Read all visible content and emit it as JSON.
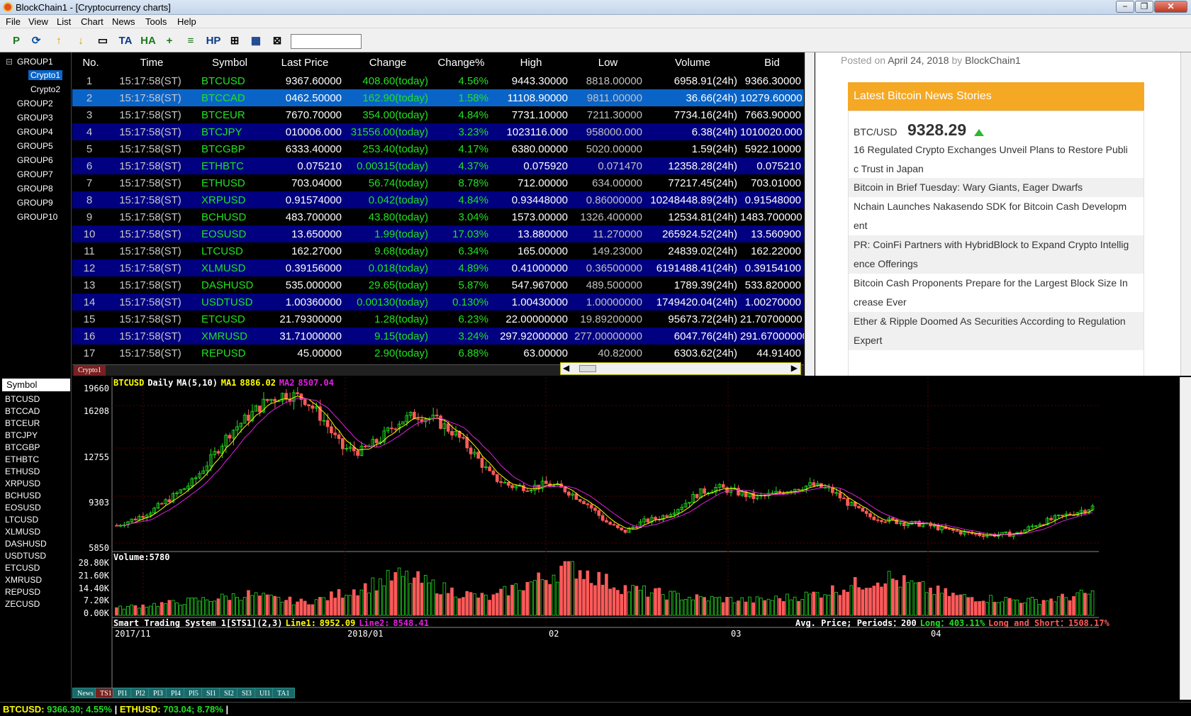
{
  "window": {
    "title": "BlockChain1 - [Cryptocurrency charts]",
    "min": "−",
    "restore": "❐",
    "close": "✕"
  },
  "menu": [
    "File",
    "View",
    "List",
    "Chart",
    "News",
    "Tools",
    "Help"
  ],
  "toolbar": {
    "buttons": [
      "P",
      "⟳",
      "↑",
      "↓",
      "▭",
      "TA",
      "HA",
      "+",
      "≡",
      "HP",
      "⊞",
      "▦",
      "⊠"
    ],
    "icons": [
      "p-icon",
      "refresh-icon",
      "up-icon",
      "down-icon",
      "window-icon",
      "ta-icon",
      "ha-icon",
      "crosshair-icon",
      "list-icon",
      "hp-icon",
      "grid-icon",
      "table-icon",
      "close-box-icon"
    ],
    "search_value": ""
  },
  "tree": {
    "groups": [
      "GROUP1",
      "Crypto1",
      "Crypto2",
      "GROUP2",
      "GROUP3",
      "GROUP4",
      "GROUP5",
      "GROUP6",
      "GROUP7",
      "GROUP8",
      "GROUP9",
      "GROUP10"
    ],
    "expand": "⊟",
    "selected": "Crypto1"
  },
  "grid": {
    "columns": [
      "No.",
      "Time",
      "Symbol",
      "Last Price",
      "Change",
      "Change%",
      "High",
      "Low",
      "Volume",
      "Bid"
    ],
    "rows": [
      [
        "1",
        "15:17:58(ST)",
        "BTCUSD",
        "9367.60000",
        "408.60(today)",
        "4.56%",
        "9443.30000",
        "8818.00000",
        "6958.91(24h)",
        "9366.30000"
      ],
      [
        "2",
        "15:17:58(ST)",
        "BTCCAD",
        "0462.50000",
        "162.90(today)",
        "1.58%",
        "11108.90000",
        "9811.00000",
        "36.66(24h)",
        "10279.60000"
      ],
      [
        "3",
        "15:17:58(ST)",
        "BTCEUR",
        "7670.70000",
        "354.00(today)",
        "4.84%",
        "7731.10000",
        "7211.30000",
        "7734.16(24h)",
        "7663.90000"
      ],
      [
        "4",
        "15:17:58(ST)",
        "BTCJPY",
        "010006.000",
        "31556.00(today)",
        "3.23%",
        "1023116.000",
        "958000.000",
        "6.38(24h)",
        "1010020.000"
      ],
      [
        "5",
        "15:17:58(ST)",
        "BTCGBP",
        "6333.40000",
        "253.40(today)",
        "4.17%",
        "6380.00000",
        "5020.00000",
        "1.59(24h)",
        "5922.10000"
      ],
      [
        "6",
        "15:17:58(ST)",
        "ETHBTC",
        "0.075210",
        "0.00315(today)",
        "4.37%",
        "0.075920",
        "0.071470",
        "12358.28(24h)",
        "0.075210"
      ],
      [
        "7",
        "15:17:58(ST)",
        "ETHUSD",
        "703.04000",
        "56.74(today)",
        "8.78%",
        "712.00000",
        "634.00000",
        "77217.45(24h)",
        "703.01000"
      ],
      [
        "8",
        "15:17:58(ST)",
        "XRPUSD",
        "0.91574000",
        "0.042(today)",
        "4.84%",
        "0.93448000",
        "0.86000000",
        "10248448.89(24h)",
        "0.91548000"
      ],
      [
        "9",
        "15:17:58(ST)",
        "BCHUSD",
        "483.700000",
        "43.80(today)",
        "3.04%",
        "1573.00000",
        "1326.400000",
        "12534.81(24h)",
        "1483.700000"
      ],
      [
        "10",
        "15:17:58(ST)",
        "EOSUSD",
        "13.650000",
        "1.99(today)",
        "17.03%",
        "13.880000",
        "11.270000",
        "265924.52(24h)",
        "13.560900"
      ],
      [
        "11",
        "15:17:58(ST)",
        "LTCUSD",
        "162.27000",
        "9.68(today)",
        "6.34%",
        "165.00000",
        "149.23000",
        "24839.02(24h)",
        "162.22000"
      ],
      [
        "12",
        "15:17:58(ST)",
        "XLMUSD",
        "0.39156000",
        "0.018(today)",
        "4.89%",
        "0.41000000",
        "0.36500000",
        "6191488.41(24h)",
        "0.39154100"
      ],
      [
        "13",
        "15:17:58(ST)",
        "DASHUSD",
        "535.000000",
        "29.65(today)",
        "5.87%",
        "547.967000",
        "489.500000",
        "1789.39(24h)",
        "533.820000"
      ],
      [
        "14",
        "15:17:58(ST)",
        "USDTUSD",
        "1.00360000",
        "0.00130(today)",
        "0.130%",
        "1.00430000",
        "1.00000000",
        "1749420.04(24h)",
        "1.00270000"
      ],
      [
        "15",
        "15:17:58(ST)",
        "ETCUSD",
        "21.79300000",
        "1.28(today)",
        "6.23%",
        "22.00000000",
        "19.89200000",
        "95673.72(24h)",
        "21.70700000"
      ],
      [
        "16",
        "15:17:58(ST)",
        "XMRUSD",
        "31.71000000",
        "9.15(today)",
        "3.24%",
        "297.92000000",
        "277.00000000",
        "6047.76(24h)",
        "291.67000000"
      ],
      [
        "17",
        "15:17:58(ST)",
        "REPUSD",
        "45.00000",
        "2.90(today)",
        "6.88%",
        "63.00000",
        "40.82000",
        "6303.62(24h)",
        "44.91400"
      ]
    ],
    "tab": "Crypto1"
  },
  "news": {
    "posted_prefix": "Posted on",
    "posted_date": "April 24, 2018",
    "posted_by": "by",
    "author": "BlockChain1",
    "heading": "Latest Bitcoin News Stories",
    "pair": "BTC/USD",
    "price": "9328.29",
    "stories": [
      [
        "16 Regulated Crypto Exchanges Unveil Plans to Restore Publi",
        "c Trust in Japan"
      ],
      [
        "Bitcoin in Brief Tuesday: Wary Giants, Eager Dwarfs"
      ],
      [
        "Nchain Launches Nakasendo SDK for Bitcoin Cash Developm",
        "ent"
      ],
      [
        "PR: CoinFi Partners with HybridBlock to Expand Crypto Intellig",
        "ence Offerings"
      ],
      [
        "Bitcoin Cash Proponents Prepare for the Largest Block Size In",
        "crease Ever"
      ],
      [
        "Ether & Ripple Doomed As Securities According to Regulation",
        "Expert"
      ]
    ]
  },
  "symbols": {
    "header": "Symbol",
    "list": [
      "BTCUSD",
      "BTCCAD",
      "BTCEUR",
      "BTCJPY",
      "BTCGBP",
      "ETHBTC",
      "ETHUSD",
      "XRPUSD",
      "BCHUSD",
      "EOSUSD",
      "LTCUSD",
      "XLMUSD",
      "DASHUSD",
      "USDTUSD",
      "ETCUSD",
      "XMRUSD",
      "REPUSD",
      "ZECUSD"
    ]
  },
  "chart": {
    "title_symbol": "BTCUSD",
    "title_period": "Daily",
    "title_ma": "MA(5,10)",
    "ma1_label": "MA1",
    "ma1_value": "8886.02",
    "ma2_label": "MA2",
    "ma2_value": "8507.04",
    "price_ticks": [
      "19660",
      "16208",
      "12755",
      "9303",
      "5850"
    ],
    "volume_label": "Volume:5780",
    "volume_ticks": [
      "28.80K",
      "21.60K",
      "14.40K",
      "7.20K",
      "0.00K"
    ],
    "sts_label": "Smart Trading System 1[STS1](2,3)",
    "line1_label": "Line1:",
    "line1_value": "8952.09",
    "line2_label": "Line2:",
    "line2_value": "8548.41",
    "avg_label": "Avg. Price; Periods：",
    "avg_value": "200",
    "long_label": "Long：",
    "long_value": "403.11%",
    "ls_label": "Long and Short：",
    "ls_value": "1508.17%",
    "date_ticks": [
      "2017/11",
      "2018/01",
      "02",
      "03",
      "04"
    ],
    "bottom_tabs": [
      "News",
      "TS1",
      "PI1",
      "PI2",
      "PI3",
      "PI4",
      "PI5",
      "SI1",
      "SI2",
      "SI3",
      "UI1",
      "TA1"
    ]
  },
  "colors": {
    "up": "#22e022",
    "down": "#ff5a5a",
    "ma1": "#ffff00",
    "ma2": "#e020e0",
    "accent": "#f5a823"
  },
  "chart_data": {
    "type": "candlestick",
    "x_range": [
      "2017/11",
      "2018/04"
    ],
    "ylim": [
      5850,
      19660
    ],
    "close_series_sampled": [
      7800,
      8400,
      9200,
      10300,
      11500,
      13500,
      15800,
      17200,
      18600,
      19200,
      18800,
      17000,
      14500,
      14200,
      15200,
      16800,
      17400,
      16900,
      15800,
      14100,
      12000,
      11200,
      11100,
      11400,
      10800,
      9800,
      8200,
      7200,
      8100,
      8500,
      9400,
      10600,
      11100,
      10700,
      10200,
      10500,
      11000,
      11300,
      10900,
      9700,
      8600,
      8300,
      8000,
      7900,
      7500,
      7200,
      7000,
      7000,
      7100,
      7900,
      8400,
      8900,
      9400
    ],
    "volume_series_sampled": [
      4000,
      5200,
      6100,
      7000,
      8200,
      9100,
      10500,
      11800,
      9800,
      8500,
      7300,
      9200,
      12500,
      15400,
      18700,
      22100,
      19800,
      16400,
      13200,
      11100,
      9600,
      14800,
      18200,
      21600,
      28800,
      24300,
      19200,
      15600,
      13500,
      12100,
      10800,
      9600,
      9200,
      8700,
      8400,
      9100,
      10200,
      11500,
      13800,
      16200,
      18800,
      21400,
      18100,
      15200,
      12600,
      10400,
      9800,
      9100,
      8600,
      8200,
      9100,
      10800,
      12400
    ]
  },
  "status": {
    "btc_label": "BTCUSD:",
    "btc_price": "9366.30;",
    "btc_pct": "4.55%",
    "sep": "|",
    "eth_label": "ETHUSD:",
    "eth_price": "703.04;",
    "eth_pct": "8.78%",
    "sep2": "|"
  }
}
